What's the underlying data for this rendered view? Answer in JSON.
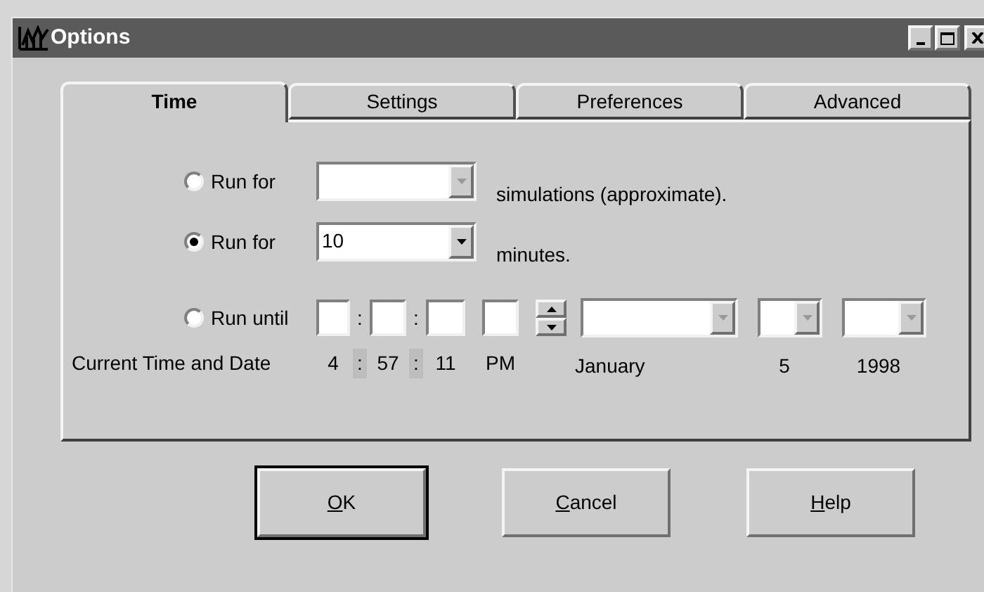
{
  "window": {
    "title": "Options"
  },
  "tabs": [
    {
      "label": "Time",
      "selected": true
    },
    {
      "label": "Settings",
      "selected": false
    },
    {
      "label": "Preferences",
      "selected": false
    },
    {
      "label": "Advanced",
      "selected": false
    }
  ],
  "run_options": [
    {
      "kind": "count",
      "label": "Run for",
      "selected": false,
      "disabled": true,
      "suffix": "simulations (approximate)."
    },
    {
      "kind": "count",
      "label": "Run for",
      "selected": true,
      "disabled": false,
      "value": "10",
      "suffix": "minutes."
    },
    {
      "kind": "until",
      "label": "Run until",
      "selected": false,
      "separators": [
        ":",
        ":"
      ]
    }
  ],
  "current": {
    "label": "Current Time and Date",
    "hour": "4",
    "minute": "57",
    "second": "11",
    "separators": [
      ":",
      ":"
    ],
    "ampm": "PM",
    "month": "January",
    "day": "5",
    "year": "1998"
  },
  "buttons": [
    {
      "label": "OK",
      "underline_first": true,
      "default": true
    },
    {
      "label": "Cancel",
      "underline_first": true,
      "default": false
    },
    {
      "label": "Help",
      "underline_first": true,
      "default": false
    }
  ]
}
